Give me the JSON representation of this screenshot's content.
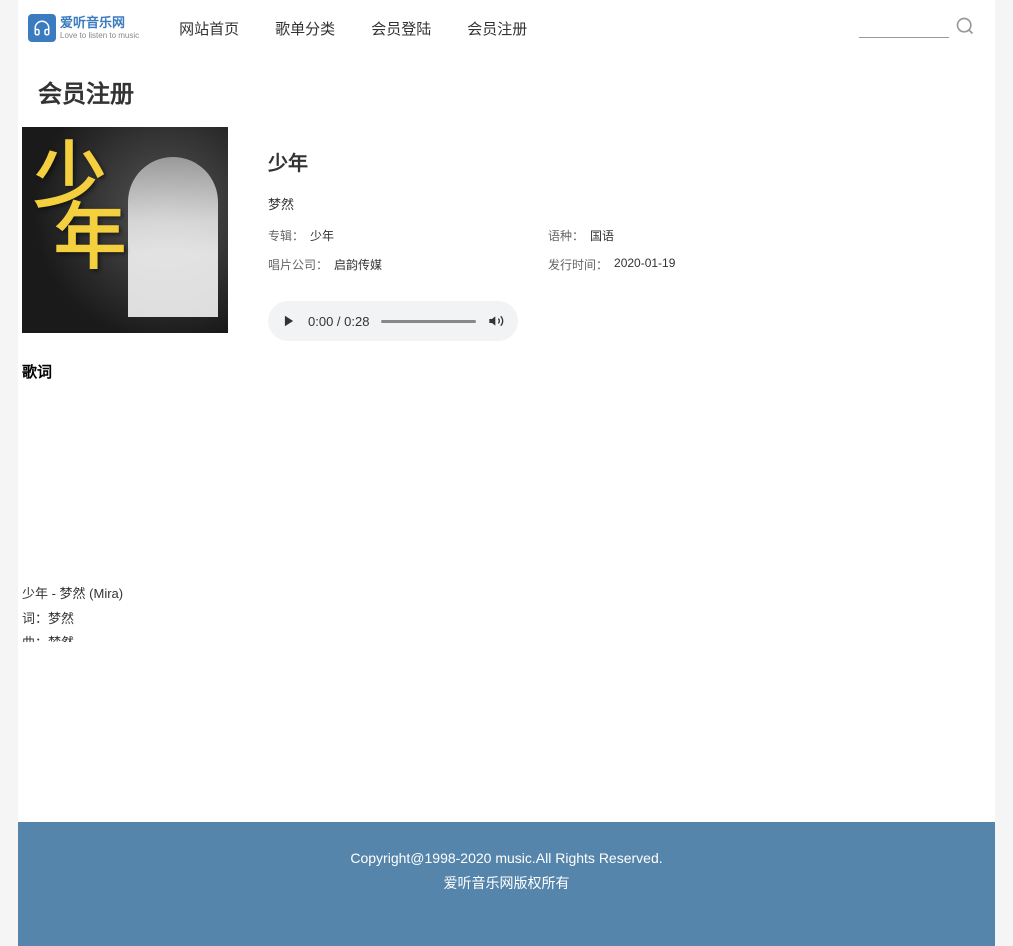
{
  "logo": {
    "title": "爱听音乐网",
    "subtitle": "Love to listen to music"
  },
  "nav": [
    "网站首页",
    "歌单分类",
    "会员登陆",
    "会员注册"
  ],
  "pageTitle": "会员注册",
  "song": {
    "title": "少年",
    "artist": "梦然",
    "meta": {
      "albumLabel": "专辑：",
      "albumValue": "少年",
      "langLabel": "语种：",
      "langValue": "国语",
      "companyLabel": "唱片公司：",
      "companyValue": "启韵传媒",
      "releaseLabel": "发行时间：",
      "releaseValue": "2020-01-19"
    },
    "player": {
      "time": "0:00 / 0:28"
    }
  },
  "lyrics": {
    "title": "歌词",
    "lines": [
      "少年 - 梦然 (Mira)",
      "词：梦然",
      "曲：梦然"
    ]
  },
  "footer": {
    "line1": "Copyright@1998-2020 music.All Rights Reserved.",
    "line2": "爱听音乐网版权所有"
  }
}
